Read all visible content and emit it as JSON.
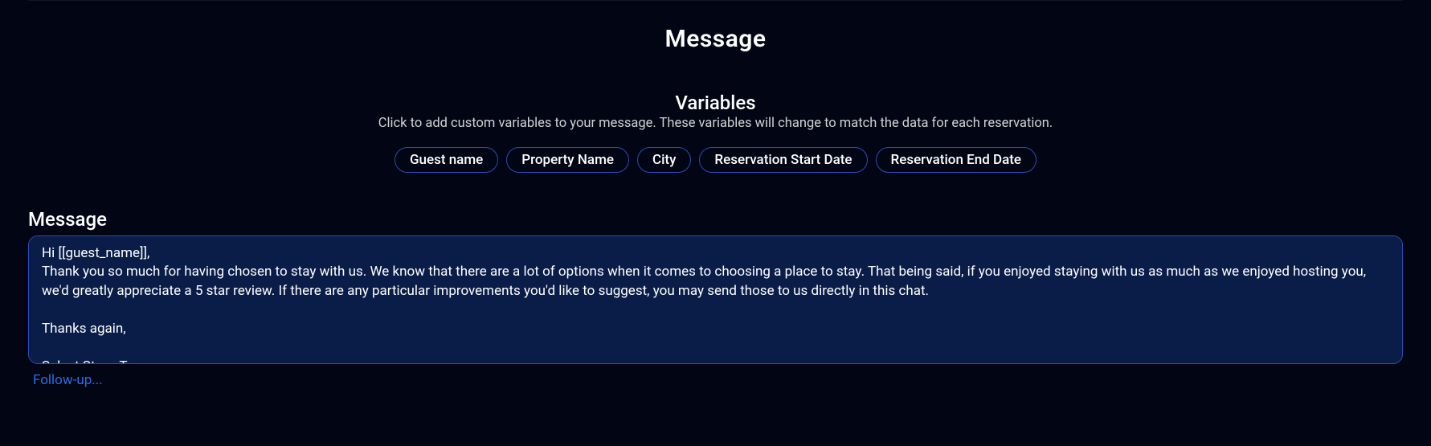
{
  "section": {
    "title": "Message"
  },
  "variables": {
    "heading": "Variables",
    "instructions": "Click to add custom variables to your message. These variables will change to match the data for each reservation.",
    "chips": [
      "Guest name",
      "Property Name",
      "City",
      "Reservation Start Date",
      "Reservation End Date"
    ]
  },
  "message": {
    "label": "Message",
    "value": "Hi [[guest_name]],\nThank you so much for having chosen to stay with us. We know that there are a lot of options when it comes to choosing a place to stay. That being said, if you enjoyed staying with us as much as we enjoyed hosting you, we'd greatly appreciate a 5 star review. If there are any particular improvements you'd like to suggest, you may send those to us directly in this chat.\n\nThanks again,\n\nSelect Stays Team"
  },
  "followup": {
    "label": "Follow-up..."
  }
}
